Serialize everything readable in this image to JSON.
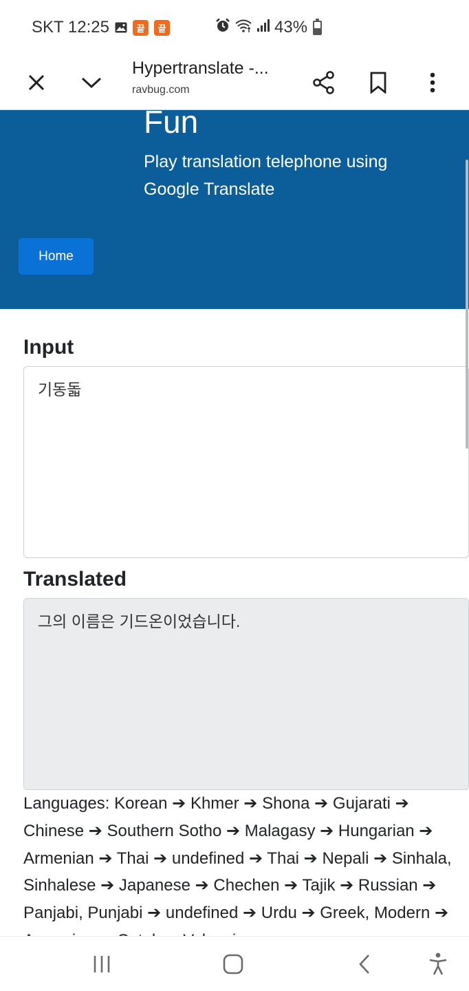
{
  "status_bar": {
    "carrier_time": "SKT 12:25",
    "app_badge_1": "끝",
    "app_badge_2": "끝",
    "battery": "43%",
    "icons": [
      "image-icon",
      "alarm-icon",
      "wifi-icon",
      "signal-icon",
      "battery-icon"
    ],
    "battery_level": 0.43
  },
  "browser": {
    "title": "Hypertranslate -...",
    "url": "ravbug.com",
    "icons": [
      "close-icon",
      "chevron-down-icon",
      "share-icon",
      "bookmark-icon",
      "more-vert-icon"
    ]
  },
  "hero": {
    "title": "Fun",
    "subtitle": "Play translation telephone using Google Translate",
    "home_button": "Home",
    "background": "#0b5e99",
    "button_color": "#0a72d6"
  },
  "main": {
    "input_label": "Input",
    "input_value": "기동돏",
    "translated_label": "Translated",
    "translated_value": "그의 이름은 기드온이었습니다.",
    "languages": "Languages: Korean ➔ Khmer ➔ Shona ➔ Gujarati ➔ Chinese ➔ Southern Sotho ➔ Malagasy ➔ Hungarian ➔ Armenian ➔ Thai ➔ undefined ➔ Thai ➔ Nepali ➔ Sinhala, Sinhalese ➔ Japanese ➔ Chechen ➔ Tajik ➔ Russian ➔ Panjabi, Punjabi ➔ undefined ➔ Urdu ➔ Greek, Modern ➔ Armenian ➔ Catalan, Valencian ➔"
  },
  "nav_bar": {
    "icons": [
      "recent-apps-icon",
      "home-icon",
      "back-icon",
      "accessibility-icon"
    ]
  }
}
